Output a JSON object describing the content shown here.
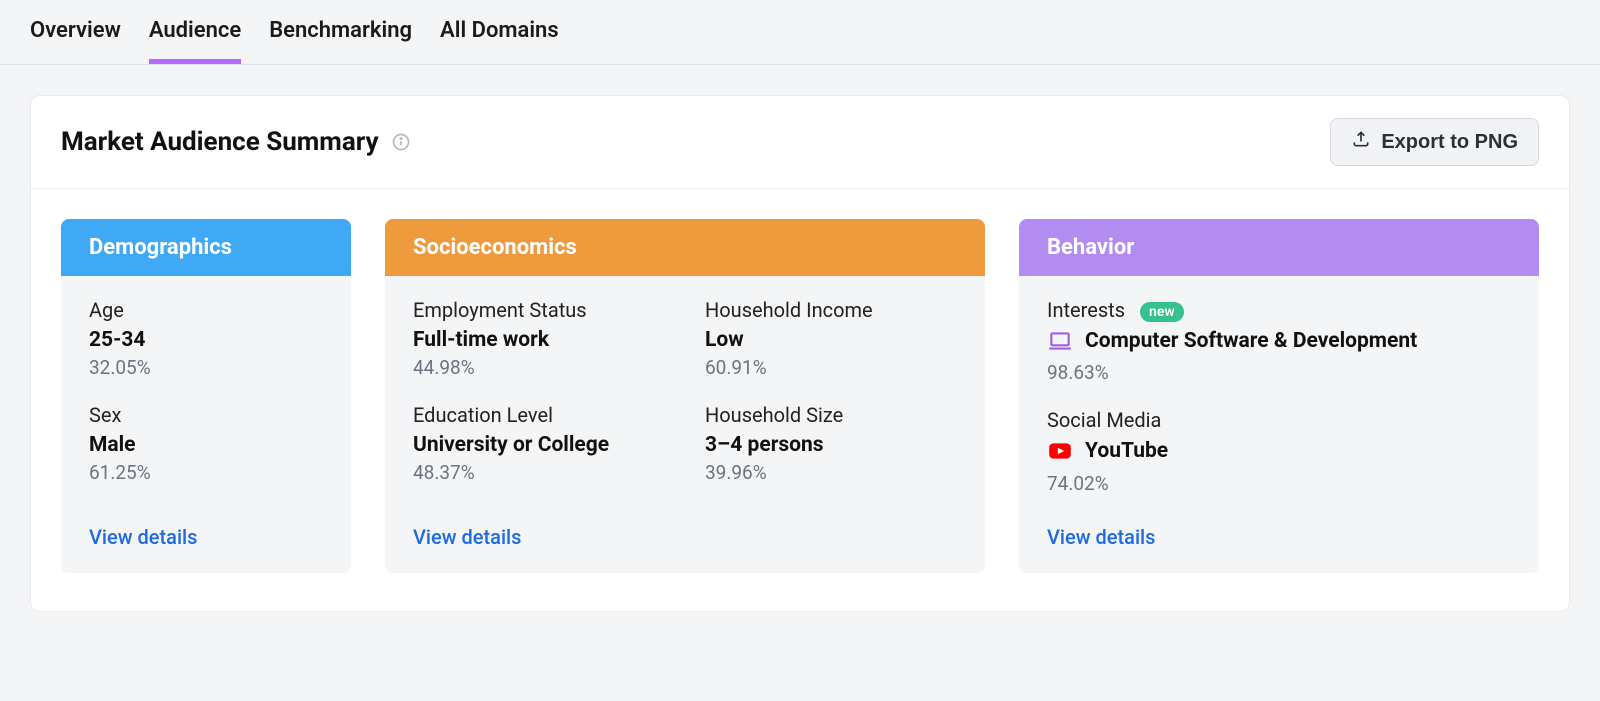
{
  "tabs": {
    "overview": "Overview",
    "audience": "Audience",
    "benchmarking": "Benchmarking",
    "all_domains": "All Domains"
  },
  "panel": {
    "title": "Market Audience Summary",
    "export_label": "Export to PNG"
  },
  "demographics": {
    "title": "Demographics",
    "age": {
      "label": "Age",
      "value": "25-34",
      "pct": "32.05%"
    },
    "sex": {
      "label": "Sex",
      "value": "Male",
      "pct": "61.25%"
    },
    "view": "View details"
  },
  "socio": {
    "title": "Socioeconomics",
    "employment": {
      "label": "Employment Status",
      "value": "Full-time work",
      "pct": "44.98%"
    },
    "income": {
      "label": "Household Income",
      "value": "Low",
      "pct": "60.91%"
    },
    "education": {
      "label": "Education Level",
      "value": "University or College",
      "pct": "48.37%"
    },
    "hhsize": {
      "label": "Household Size",
      "value": "3–4 persons",
      "pct": "39.96%"
    },
    "view": "View details"
  },
  "behavior": {
    "title": "Behavior",
    "interests": {
      "label": "Interests",
      "badge": "new",
      "value": "Computer Software & Development",
      "pct": "98.63%"
    },
    "social": {
      "label": "Social Media",
      "value": "YouTube",
      "pct": "74.02%"
    },
    "view": "View details"
  }
}
